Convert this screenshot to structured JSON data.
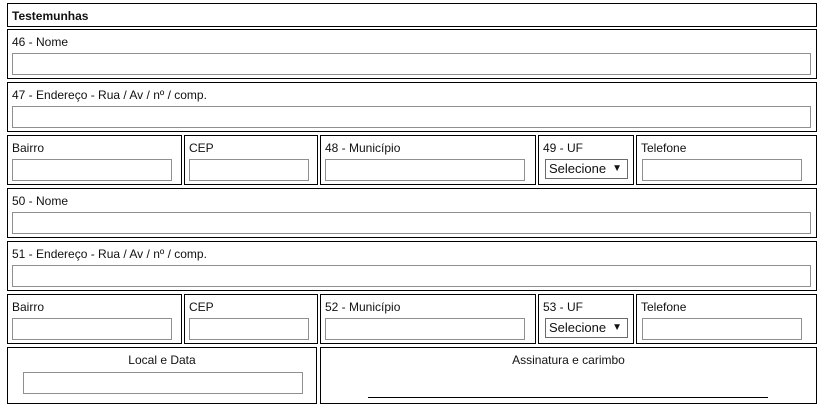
{
  "section_title": "Testemunhas",
  "witness1": {
    "name_label": "46 - Nome",
    "name_value": "",
    "address_label": "47 - Endereço - Rua / Av / nº / comp.",
    "address_value": "",
    "bairro_label": "Bairro",
    "bairro_value": "",
    "cep_label": "CEP",
    "cep_value": "",
    "municipio_label": "48 - Município",
    "municipio_value": "",
    "uf_label": "49 - UF",
    "uf_selected": "Selecione",
    "telefone_label": "Telefone",
    "telefone_value": ""
  },
  "witness2": {
    "name_label": "50 - Nome",
    "name_value": "",
    "address_label": "51 - Endereço - Rua / Av / nº / comp.",
    "address_value": "",
    "bairro_label": "Bairro",
    "bairro_value": "",
    "cep_label": "CEP",
    "cep_value": "",
    "municipio_label": "52 - Município",
    "municipio_value": "",
    "uf_label": "53 - UF",
    "uf_selected": "Selecione",
    "telefone_label": "Telefone",
    "telefone_value": ""
  },
  "footer": {
    "local_data_label": "Local e Data",
    "local_data_value": "",
    "signature_label": "Assinatura e carimbo"
  },
  "icons": {
    "dropdown": "triangle-down-icon"
  }
}
